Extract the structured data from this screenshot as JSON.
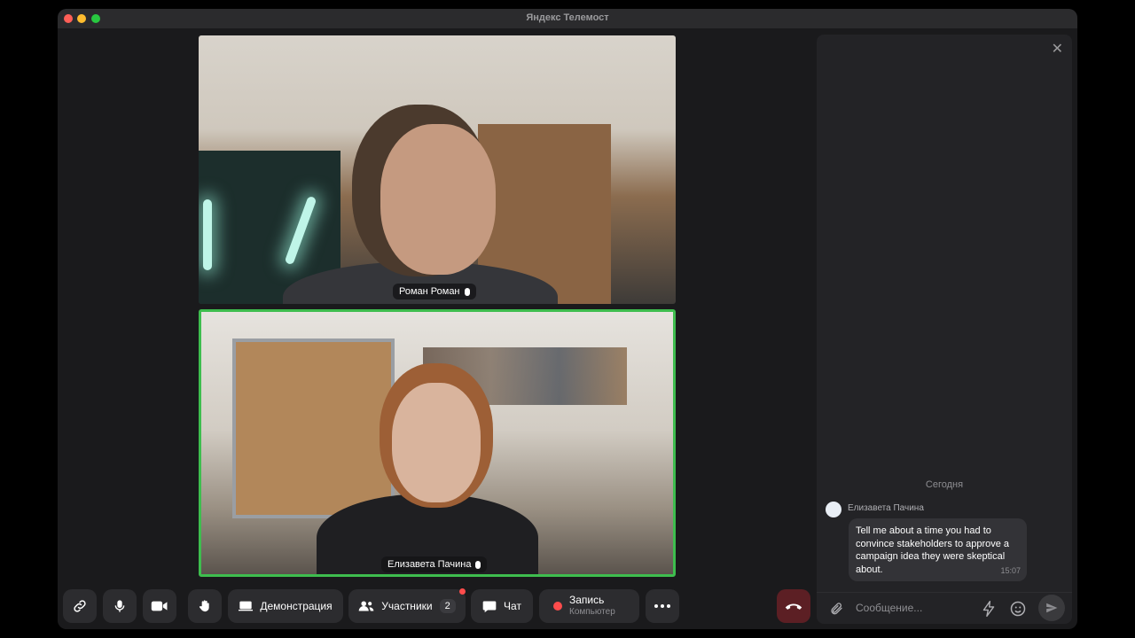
{
  "window": {
    "title": "Яндекс Телемост"
  },
  "participants": [
    {
      "name": "Роман Роман"
    },
    {
      "name": "Елизавета Пачина",
      "speaking": true
    }
  ],
  "toolbar": {
    "link_icon": "link-icon",
    "mic_icon": "mic-icon",
    "camera_icon": "camera-icon",
    "hand_icon": "hand-icon",
    "demo_label": "Демонстрация",
    "participants_label": "Участники",
    "participants_count": "2",
    "chat_label": "Чат",
    "record_label": "Запись",
    "record_sub": "Компьютер",
    "more_icon": "more-icon",
    "hangup_icon": "hang-up-icon"
  },
  "chat": {
    "day_label": "Сегодня",
    "messages": [
      {
        "author": "Елизавета Пачина",
        "text": "Tell me about a time you had to convince stakeholders to approve a campaign idea they were skeptical about.",
        "time": "15:07"
      }
    ],
    "input_placeholder": "Сообщение..."
  },
  "colors": {
    "speaking_border": "#3ebd4e",
    "record_dot": "#ff4c4c",
    "hangup_bg": "#5c1f24"
  }
}
